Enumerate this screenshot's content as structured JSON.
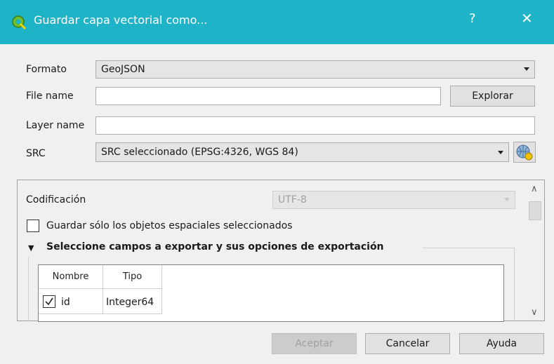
{
  "window": {
    "title": "Guardar capa vectorial como...",
    "help_label": "?",
    "close_label": "✕",
    "titlebar_color": "#1eb3c6"
  },
  "form": {
    "formato_label": "Formato",
    "formato_value": "GeoJSON",
    "filename_label": "File name",
    "filename_value": "",
    "explorar_label": "Explorar",
    "layername_label": "Layer name",
    "layername_value": "",
    "src_label": "SRC",
    "src_value": "SRC seleccionado (EPSG:4326, WGS 84)"
  },
  "options": {
    "codificacion_label": "Codificación",
    "codificacion_value": "UTF-8",
    "only_selected_label": "Guardar sólo los objetos espaciales seleccionados",
    "only_selected_checked": false,
    "fields_group_title": "Seleccione campos a exportar y sus opciones de exportación",
    "fields_table": {
      "columns": [
        "Nombre",
        "Tipo"
      ],
      "rows": [
        {
          "checked": true,
          "name": "id",
          "type": "Integer64"
        }
      ]
    }
  },
  "buttons": {
    "accept": "Aceptar",
    "cancel": "Cancelar",
    "help": "Ayuda"
  }
}
